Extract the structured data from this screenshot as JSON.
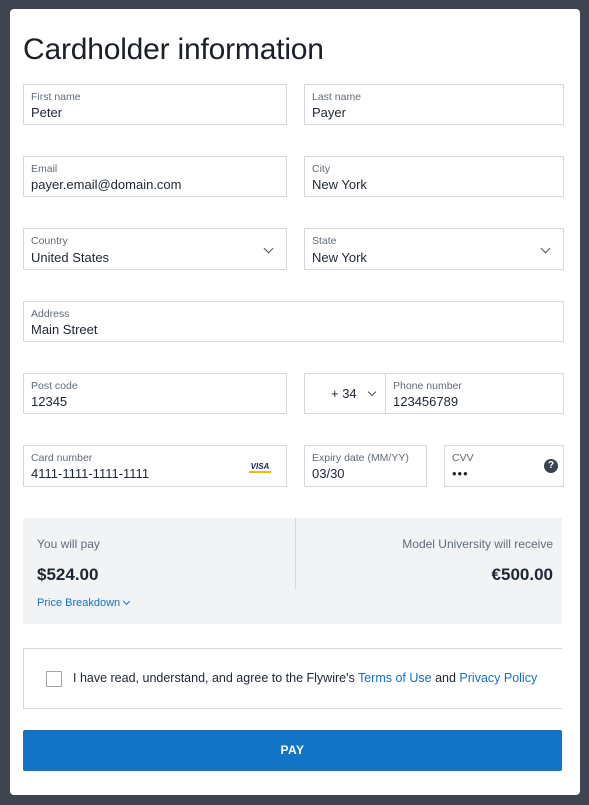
{
  "page": {
    "title": "Cardholder information"
  },
  "form": {
    "first_name": {
      "label": "First name",
      "value": "Peter"
    },
    "last_name": {
      "label": "Last name",
      "value": "Payer"
    },
    "email": {
      "label": "Email",
      "value": "payer.email@domain.com"
    },
    "city": {
      "label": "City",
      "value": "New York"
    },
    "country": {
      "label": "Country",
      "value": "United States"
    },
    "state": {
      "label": "State",
      "value": "New York"
    },
    "address": {
      "label": "Address",
      "value": "Main Street"
    },
    "post_code": {
      "label": "Post code",
      "value": "12345"
    },
    "phone_prefix": {
      "value": "+ 34"
    },
    "phone_number": {
      "label": "Phone number",
      "value": "123456789"
    },
    "card_number": {
      "label": "Card number",
      "value": "4111-1111-1111-1111",
      "brand": "VISA"
    },
    "expiry": {
      "label": "Expiry date (MM/YY)",
      "value": "03/30"
    },
    "cvv": {
      "label": "CVV",
      "value": "•••",
      "help": "?"
    }
  },
  "summary": {
    "you_pay_label": "You will pay",
    "you_pay_amount": "$524.00",
    "breakdown_link": "Price Breakdown",
    "receive_label": "Model University will receive",
    "receive_amount": "€500.00"
  },
  "agreement": {
    "text_prefix": "I have read, understand, and agree to the Flywire's ",
    "terms_link": "Terms of Use",
    "and_text": " and ",
    "privacy_link": "Privacy Policy",
    "checked": false
  },
  "pay_button": {
    "label": "PAY"
  },
  "colors": {
    "accent": "#1273c7",
    "link": "#1a6fc0",
    "background": "#3f4550",
    "summary_bg": "#f2f3f5",
    "visa_blue": "#1a1f71",
    "visa_gold": "#f7b600"
  },
  "icons": {
    "select_chevron": "chevron-down-icon",
    "card_brand": "visa-icon",
    "cvv_help": "help-icon"
  }
}
